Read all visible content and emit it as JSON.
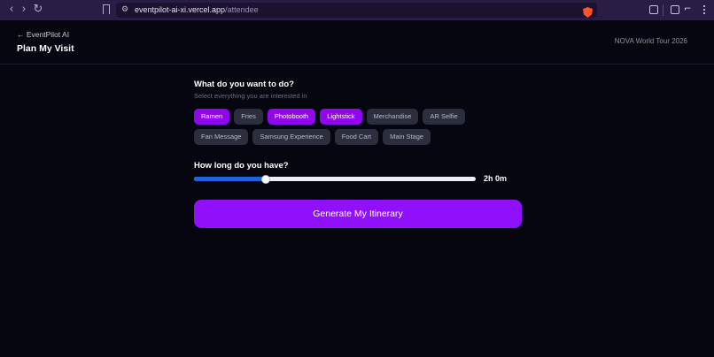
{
  "browser": {
    "url_host": "eventpilot-ai-xi.vercel.app",
    "url_path": "/attendee",
    "icons": [
      "back-arrow-icon",
      "forward-arrow-icon",
      "reload-icon",
      "bookmark-icon",
      "site-settings-icon",
      "brave-shield-icon",
      "reader-mode-icon",
      "sidebar-icon",
      "glasses-icon",
      "menu-icon"
    ]
  },
  "header": {
    "back_link": "← EventPilot AI",
    "title": "Plan My Visit",
    "tour_name": "NOVA World Tour 2026"
  },
  "interests": {
    "heading": "What do you want to do?",
    "subheading": "Select everything you are interested in",
    "options": [
      {
        "label": "Ramen",
        "selected": true
      },
      {
        "label": "Fries",
        "selected": false
      },
      {
        "label": "Photobooth",
        "selected": true
      },
      {
        "label": "Lightstick",
        "selected": true
      },
      {
        "label": "Merchandise",
        "selected": false
      },
      {
        "label": "AR Selfie",
        "selected": false
      },
      {
        "label": "Fan Message",
        "selected": false
      },
      {
        "label": "Samsung Experience",
        "selected": false
      },
      {
        "label": "Food Cart",
        "selected": false
      },
      {
        "label": "Main Stage",
        "selected": false
      }
    ]
  },
  "duration": {
    "heading": "How long do you have?",
    "value_label": "2h 0m",
    "slider_fraction": 0.255
  },
  "cta": {
    "label": "Generate My Itinerary"
  },
  "colors": {
    "accent": "#9010fb",
    "chip_selected": "#8f06ef",
    "chip_unselected": "#2a2e3d",
    "slider_fill": "#1f63d8",
    "background": "#05060f"
  }
}
